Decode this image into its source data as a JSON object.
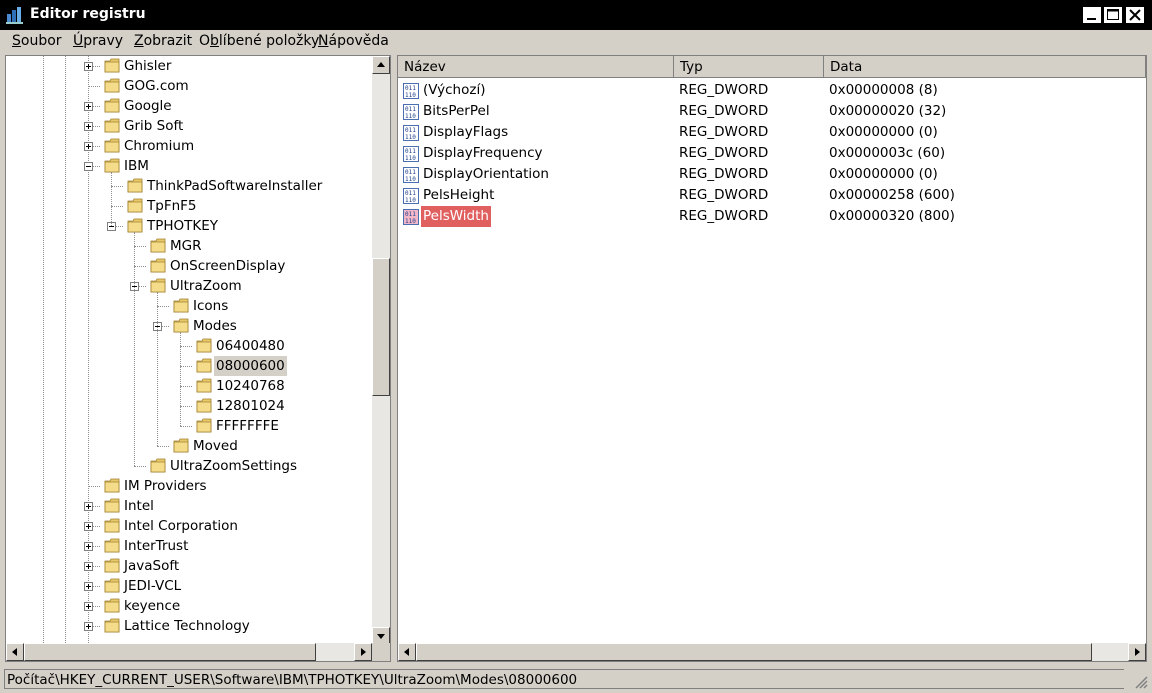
{
  "window": {
    "title": "Editor registru"
  },
  "menu": [
    {
      "label_pre": "",
      "label_u": "S",
      "label_post": "oubor"
    },
    {
      "label_pre": "",
      "label_u": "Ú",
      "label_post": "pravy"
    },
    {
      "label_pre": "",
      "label_u": "Z",
      "label_post": "obrazit"
    },
    {
      "label_pre": "O",
      "label_u": "b",
      "label_post": "líbené položky"
    },
    {
      "label_pre": "",
      "label_u": "N",
      "label_post": "ápověda"
    }
  ],
  "tree": {
    "items": [
      {
        "label": "Ghisler",
        "level": 0,
        "expander": "plus"
      },
      {
        "label": "GOG.com",
        "level": 0,
        "expander": "none"
      },
      {
        "label": "Google",
        "level": 0,
        "expander": "plus"
      },
      {
        "label": "Grib Soft",
        "level": 0,
        "expander": "plus"
      },
      {
        "label": "Chromium",
        "level": 0,
        "expander": "plus"
      },
      {
        "label": "IBM",
        "level": 0,
        "expander": "minus"
      },
      {
        "label": "ThinkPadSoftwareInstaller",
        "level": 1,
        "expander": "none"
      },
      {
        "label": "TpFnF5",
        "level": 1,
        "expander": "none"
      },
      {
        "label": "TPHOTKEY",
        "level": 1,
        "expander": "minus"
      },
      {
        "label": "MGR",
        "level": 2,
        "expander": "none"
      },
      {
        "label": "OnScreenDisplay",
        "level": 2,
        "expander": "none"
      },
      {
        "label": "UltraZoom",
        "level": 2,
        "expander": "minus"
      },
      {
        "label": "Icons",
        "level": 3,
        "expander": "none"
      },
      {
        "label": "Modes",
        "level": 3,
        "expander": "minus"
      },
      {
        "label": "06400480",
        "level": 4,
        "expander": "none"
      },
      {
        "label": "08000600",
        "level": 4,
        "expander": "none",
        "selected": true
      },
      {
        "label": "10240768",
        "level": 4,
        "expander": "none"
      },
      {
        "label": "12801024",
        "level": 4,
        "expander": "none"
      },
      {
        "label": "FFFFFFFE",
        "level": 4,
        "expander": "none"
      },
      {
        "label": "Moved",
        "level": 3,
        "expander": "none"
      },
      {
        "label": "UltraZoomSettings",
        "level": 2,
        "expander": "none"
      },
      {
        "label": "IM Providers",
        "level": 0,
        "expander": "none"
      },
      {
        "label": "Intel",
        "level": 0,
        "expander": "plus"
      },
      {
        "label": "Intel Corporation",
        "level": 0,
        "expander": "plus"
      },
      {
        "label": "InterTrust",
        "level": 0,
        "expander": "plus"
      },
      {
        "label": "JavaSoft",
        "level": 0,
        "expander": "plus"
      },
      {
        "label": "JEDI-VCL",
        "level": 0,
        "expander": "plus"
      },
      {
        "label": "keyence",
        "level": 0,
        "expander": "plus"
      },
      {
        "label": "Lattice Technology",
        "level": 0,
        "expander": "plus"
      }
    ]
  },
  "list": {
    "columns": [
      "Název",
      "Typ",
      "Data"
    ],
    "rows": [
      {
        "name": "(Výchozí)",
        "type": "REG_DWORD",
        "data": "0x00000008 (8)"
      },
      {
        "name": "BitsPerPel",
        "type": "REG_DWORD",
        "data": "0x00000020 (32)"
      },
      {
        "name": "DisplayFlags",
        "type": "REG_DWORD",
        "data": "0x00000000 (0)"
      },
      {
        "name": "DisplayFrequency",
        "type": "REG_DWORD",
        "data": "0x0000003c (60)"
      },
      {
        "name": "DisplayOrientation",
        "type": "REG_DWORD",
        "data": "0x00000000 (0)"
      },
      {
        "name": "PelsHeight",
        "type": "REG_DWORD",
        "data": "0x00000258 (600)"
      },
      {
        "name": "PelsWidth",
        "type": "REG_DWORD",
        "data": "0x00000320 (800)",
        "highlight": true
      }
    ]
  },
  "status": {
    "path": "Počítač\\HKEY_CURRENT_USER\\Software\\IBM\\TPHOTKEY\\UltraZoom\\Modes\\08000600"
  },
  "colors": {
    "highlight": "#e0605f",
    "titlebar": "#000000",
    "chrome": "#d4d0c8"
  },
  "icons": {
    "folder": "folder-icon",
    "dword": "reg-dword-icon",
    "app": "registry-editor-icon"
  }
}
